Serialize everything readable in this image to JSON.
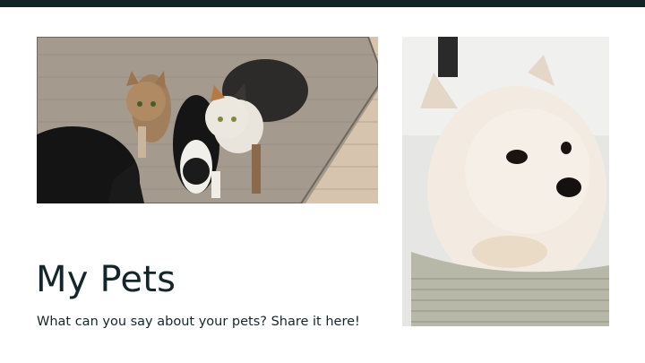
{
  "slide": {
    "title": "My Pets",
    "subtitle": "What can you say about your pets? Share it here!"
  },
  "colors": {
    "top_bar": "#132426",
    "text": "#15262a",
    "background": "#ffffff"
  },
  "images": {
    "left": "cats-on-rug-photo",
    "right": "pomeranian-dog-photo"
  }
}
